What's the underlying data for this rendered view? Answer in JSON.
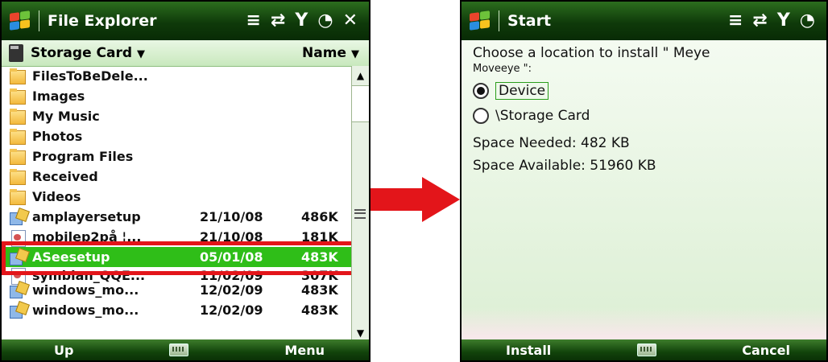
{
  "left": {
    "title": "File Explorer",
    "location": "Storage Card",
    "sort": "Name",
    "title_icons": [
      "menu-list-icon",
      "connectivity-icon",
      "signal-icon",
      "volume-icon"
    ],
    "close_label": "✕",
    "files": [
      {
        "name": "FilesToBeDele...",
        "date": "",
        "size": "",
        "icon": "folder-icon"
      },
      {
        "name": "Images",
        "date": "",
        "size": "",
        "icon": "folder-icon"
      },
      {
        "name": "My Music",
        "date": "",
        "size": "",
        "icon": "folder-icon"
      },
      {
        "name": "Photos",
        "date": "",
        "size": "",
        "icon": "folder-icon"
      },
      {
        "name": "Program Files",
        "date": "",
        "size": "",
        "icon": "folder-icon"
      },
      {
        "name": "Received",
        "date": "",
        "size": "",
        "icon": "folder-icon"
      },
      {
        "name": "Videos",
        "date": "",
        "size": "",
        "icon": "folder-icon"
      },
      {
        "name": "amplayersetup",
        "date": "21/10/08",
        "size": "486K",
        "icon": "setup-icon"
      },
      {
        "name": "mobilep2på ¦...",
        "date": "21/10/08",
        "size": "181K",
        "icon": "document-icon"
      },
      {
        "name": "ASeesetup",
        "date": "05/01/08",
        "size": "483K",
        "icon": "setup-icon",
        "selected": true
      },
      {
        "name": "symbian_QQE...",
        "date": "11/02/09",
        "size": "307K",
        "icon": "document-icon"
      },
      {
        "name": "windows_mo...",
        "date": "12/02/09",
        "size": "483K",
        "icon": "setup-icon"
      },
      {
        "name": "windows_mo...",
        "date": "12/02/09",
        "size": "483K",
        "icon": "setup-icon"
      }
    ],
    "softkeys": {
      "left": "Up",
      "right": "Menu"
    }
  },
  "right": {
    "title": "Start",
    "prompt_line1": "Choose a location to install \" Meye",
    "prompt_line2": "Moveeye \":",
    "options": [
      {
        "label": "Device",
        "checked": true
      },
      {
        "label": "\\Storage Card",
        "checked": false
      }
    ],
    "space_needed": "Space Needed:  482 KB",
    "space_available": "Space Available: 51960 KB",
    "softkeys": {
      "left": "Install",
      "right": "Cancel"
    }
  },
  "colors": {
    "arrow": "#e3151a",
    "highlight": "#e3151a",
    "selected_row": "#2fbe18",
    "titlebar": "#0f3a0a"
  }
}
